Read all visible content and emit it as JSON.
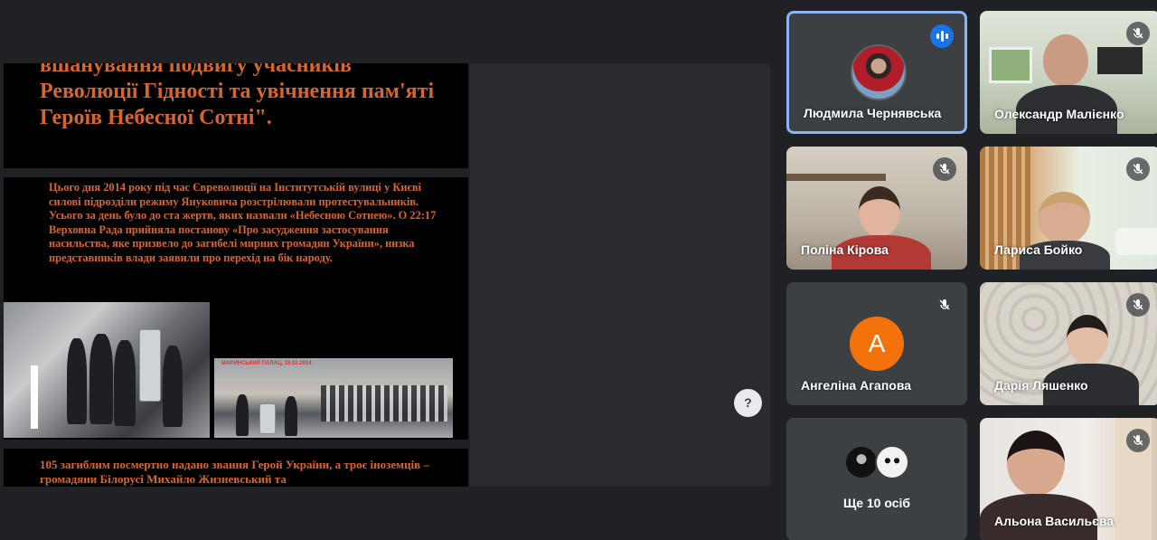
{
  "slide": {
    "title": "вшанування подвигу учасників Революції Гідності та увічнення пам'яті Героїв Небесної Сотні\".",
    "paragraph": "Цього дня 2014 року під час Євреволюції на Інститутській вулиці у Києві силові підрозділи режиму Януковича розстрілювали протестувальників. Усього за день було до ста жертв, яких назвали «Небесною Сотнею». О 22:17 Верховна Рада прийняла постанову «Про засудження застосування насильства, яке призвело до загибелі мирних громадян України», низка представників влади заявили про перехід на бік народу.",
    "photo_caption": "МАРИНСЬКИЙ ПАЛАЦ, 18.02.2014",
    "footer": "105 загиблим посмертно надано звання Герой України, а троє іноземців – громадяни Білорусі Михайло Жизневський та"
  },
  "help": {
    "label": "?"
  },
  "participants": [
    {
      "name": "Людмила Чернявська",
      "status": "speaking"
    },
    {
      "name": "Олександр Малієнко",
      "status": "muted"
    },
    {
      "name": "Поліна Кірова",
      "status": "muted"
    },
    {
      "name": "Лариса Бойко",
      "status": "muted"
    },
    {
      "name": "Ангеліна Агапова",
      "status": "muted",
      "initial": "А"
    },
    {
      "name": "Дарія Ляшенко",
      "status": "muted"
    },
    {
      "name": "Альона Васильєва",
      "status": "muted"
    }
  ],
  "more": {
    "label": "Ще 10 осіб"
  },
  "colors": {
    "speaking_accent": "#1a73e8",
    "active_border": "#8ab4f8",
    "avatar_orange": "#f4720b",
    "slide_text": "#d9652e"
  }
}
